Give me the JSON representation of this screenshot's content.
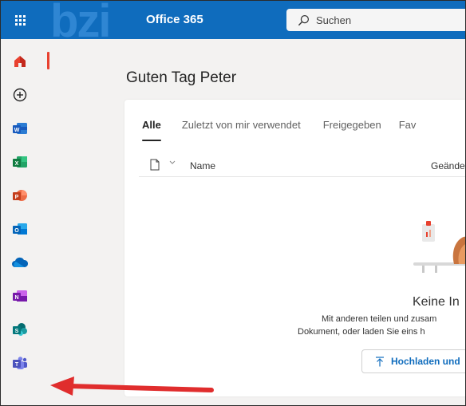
{
  "colors": {
    "topbar": "#0f6cbd",
    "accent_red": "#e8412f",
    "brand_blue": "#2f86d3"
  },
  "topbar": {
    "logo_text": "bzi",
    "app_title": "Office 365",
    "search_placeholder": "Suchen"
  },
  "rail": {
    "icons": [
      "home-icon",
      "create-icon",
      "word-icon",
      "excel-icon",
      "powerpoint-icon",
      "outlook-icon",
      "onedrive-icon",
      "onenote-icon",
      "sharepoint-icon",
      "teams-icon"
    ]
  },
  "main": {
    "greeting": "Guten Tag Peter",
    "tabs": [
      {
        "label": "Alle"
      },
      {
        "label": "Zuletzt von mir verwendet"
      },
      {
        "label": "Freigegeben"
      },
      {
        "label": "Fav"
      }
    ],
    "columns": {
      "name": "Name",
      "changed": "Geände"
    },
    "empty_state": {
      "title": "Keine In",
      "line1": "Mit anderen teilen und zusam",
      "line2": "Dokument, oder laden Sie eins h",
      "upload_label": "Hochladen und"
    }
  }
}
